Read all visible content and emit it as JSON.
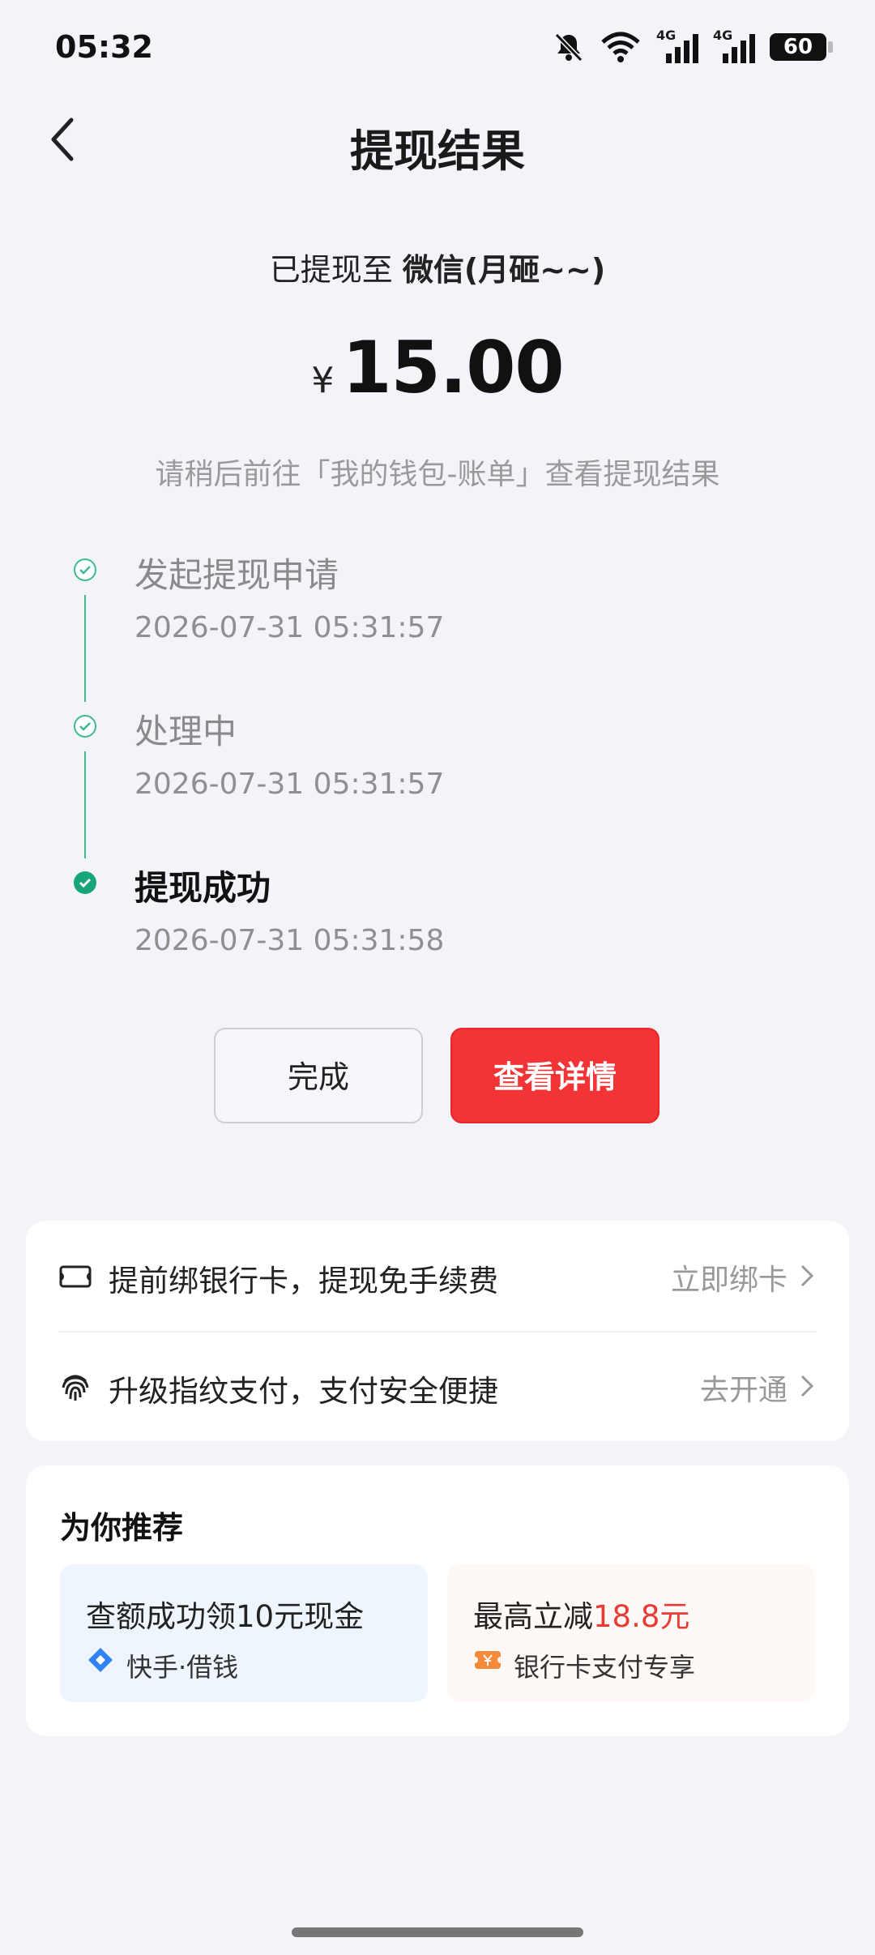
{
  "status_bar": {
    "time": "05:32",
    "net1_label": "4G",
    "net2_label": "4G",
    "battery": "60"
  },
  "header": {
    "title": "提现结果"
  },
  "result": {
    "destination_prefix": "已提现至",
    "destination": "微信(月砸~~)",
    "currency": "¥",
    "amount": "15.00",
    "hint": "请稍后前往「我的钱包-账单」查看提现结果"
  },
  "timeline": [
    {
      "title": "发起提现申请",
      "time": "2026-07-31 05:31:57"
    },
    {
      "title": "处理中",
      "time": "2026-07-31 05:31:57"
    },
    {
      "title": "提现成功",
      "time": "2026-07-31 05:31:58"
    }
  ],
  "actions": {
    "done_label": "完成",
    "detail_label": "查看详情"
  },
  "promos": [
    {
      "icon": "card-icon",
      "text": "提前绑银行卡，提现免手续费",
      "action": "立即绑卡"
    },
    {
      "icon": "fingerprint-icon",
      "text": "升级指纹支付，支付安全便捷",
      "action": "去开通"
    }
  ],
  "recommend": {
    "title": "为你推荐",
    "tiles": [
      {
        "heading": "查额成功领10元现金",
        "sub": "快手·借钱",
        "icon": "diamond-icon"
      },
      {
        "heading_prefix": "最高立减",
        "heading_highlight": "18.8元",
        "sub": "银行卡支付专享",
        "icon": "coupon-icon"
      }
    ]
  },
  "colors": {
    "accent_red": "#f23437",
    "success_green": "#3dbb8d",
    "background": "#f3f4f9"
  }
}
